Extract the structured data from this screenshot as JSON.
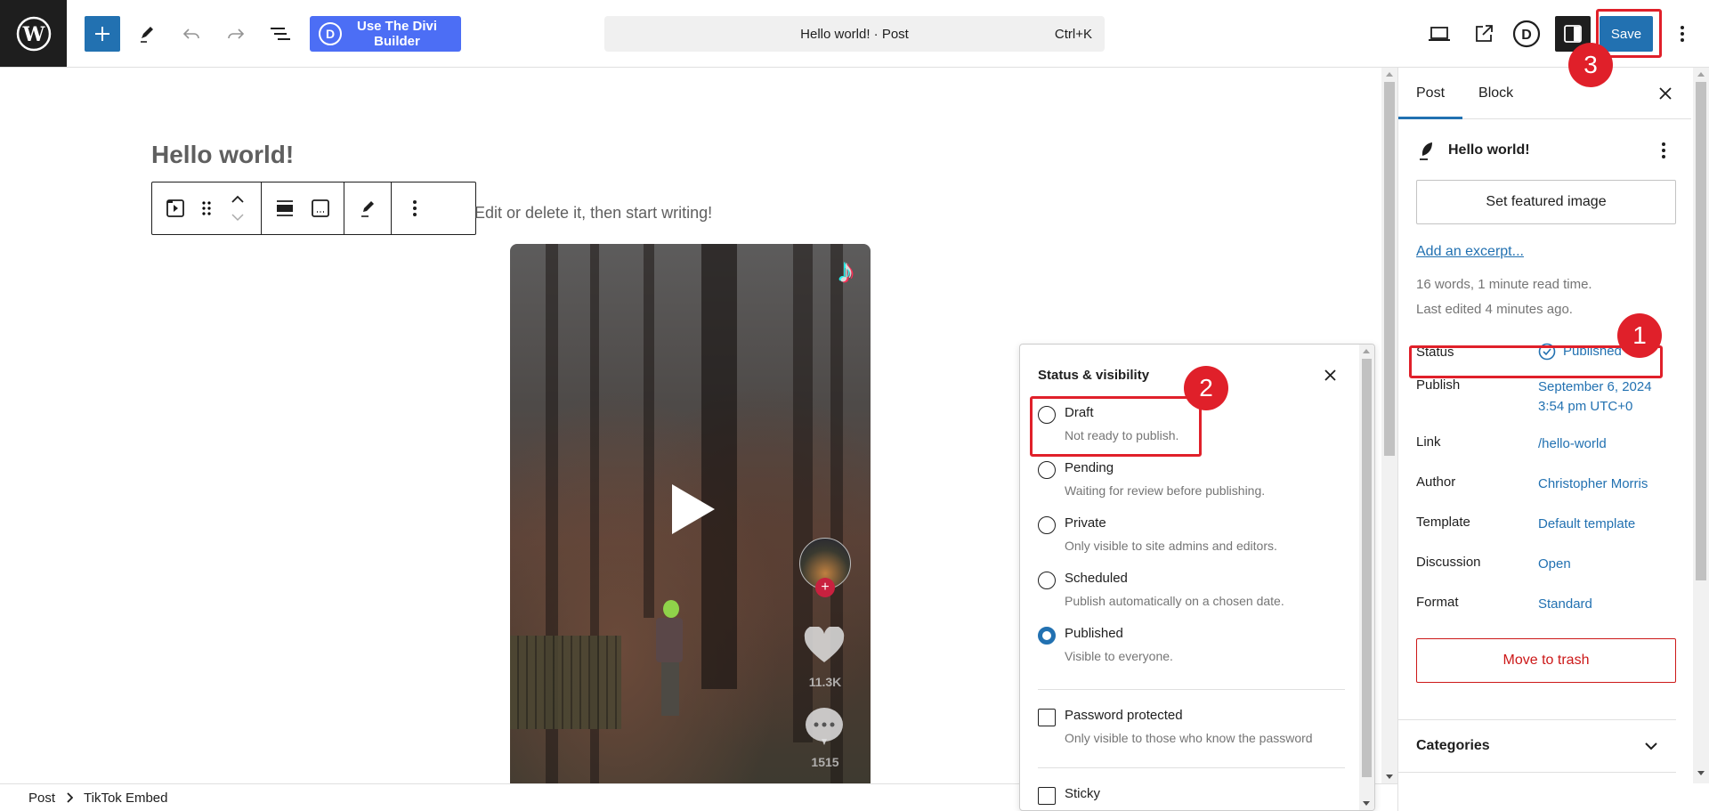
{
  "topbar": {
    "divi_button_label": "Use The Divi Builder",
    "divi_icon_letter": "D",
    "command_bar_text": "Hello world! · Post",
    "command_bar_shortcut": "Ctrl+K",
    "save_label": "Save",
    "icons": [
      "wordpress-logo",
      "plus",
      "pencil-tools",
      "undo",
      "redo",
      "document-overview",
      "divi-d",
      "preview-laptop",
      "external-link",
      "divi-circle-d",
      "settings-sidebar",
      "more-vertical"
    ]
  },
  "editor": {
    "post_title": "Hello world!",
    "paragraph_text": "Edit or delete it, then start writing!",
    "block_toolbar_icons": [
      "tiktok-embed-block",
      "drag-handle",
      "move-up",
      "move-down",
      "align",
      "caption",
      "edit-pencil",
      "more-options"
    ],
    "embed": {
      "platform": "TikTok",
      "like_count": "11.3K",
      "comment_count": "1515"
    }
  },
  "breadcrumb": {
    "items": [
      "Post",
      "TikTok Embed"
    ]
  },
  "sidebar": {
    "tabs": [
      {
        "label": "Post",
        "active": true
      },
      {
        "label": "Block",
        "active": false
      }
    ],
    "post_title": "Hello world!",
    "set_featured_image_label": "Set featured image",
    "add_excerpt_label": "Add an excerpt...",
    "word_count_text": "16 words, 1 minute read time.",
    "last_edited_text": "Last edited 4 minutes ago.",
    "fields": [
      {
        "key": "Status",
        "value": "Published"
      },
      {
        "key": "Publish",
        "value_line1": "September 6, 2024",
        "value_line2": "3:54 pm UTC+0"
      },
      {
        "key": "Link",
        "value": "/hello-world"
      },
      {
        "key": "Author",
        "value": "Christopher Morris"
      },
      {
        "key": "Template",
        "value": "Default template"
      },
      {
        "key": "Discussion",
        "value": "Open"
      },
      {
        "key": "Format",
        "value": "Standard"
      }
    ],
    "move_to_trash_label": "Move to trash",
    "categories_label": "Categories"
  },
  "status_popover": {
    "title": "Status & visibility",
    "options": [
      {
        "label": "Draft",
        "description": "Not ready to publish.",
        "selected": false
      },
      {
        "label": "Pending",
        "description": "Waiting for review before publishing.",
        "selected": false
      },
      {
        "label": "Private",
        "description": "Only visible to site admins and editors.",
        "selected": false
      },
      {
        "label": "Scheduled",
        "description": "Publish automatically on a chosen date.",
        "selected": false
      },
      {
        "label": "Published",
        "description": "Visible to everyone.",
        "selected": true
      }
    ],
    "password_protected": {
      "label": "Password protected",
      "description": "Only visible to those who know the password",
      "checked": false
    },
    "sticky": {
      "label": "Sticky",
      "checked": false
    }
  },
  "annotations": {
    "step1": "1",
    "step2": "2",
    "step3": "3",
    "highlight_color": "#e0202a"
  },
  "colors": {
    "wp_blue": "#2271b1",
    "divi_blue": "#4c6ef5",
    "danger": "#cc1818",
    "dark": "#1e1e1e"
  }
}
